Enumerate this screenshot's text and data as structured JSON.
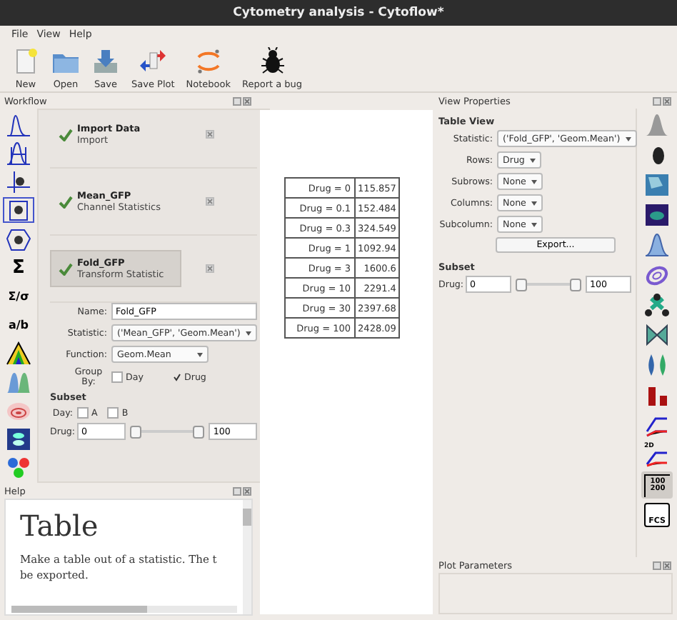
{
  "window": {
    "title": "Cytometry analysis - Cytoflow*"
  },
  "menu": [
    "File",
    "View",
    "Help"
  ],
  "toolbar": [
    {
      "kind": "new",
      "label": "New"
    },
    {
      "kind": "open",
      "label": "Open"
    },
    {
      "kind": "save",
      "label": "Save"
    },
    {
      "kind": "saveplot",
      "label": "Save Plot"
    },
    {
      "kind": "notebook",
      "label": "Notebook"
    },
    {
      "kind": "bug",
      "label": "Report a bug"
    }
  ],
  "workflow": {
    "title": "Workflow",
    "operations": [
      {
        "kind": "hist"
      },
      {
        "kind": "range"
      },
      {
        "kind": "threshold"
      },
      {
        "kind": "quad",
        "selected": true
      },
      {
        "kind": "polygon"
      },
      {
        "kind": "glyph",
        "text": "Σ"
      },
      {
        "kind": "glyph",
        "text": "Σ/σ"
      },
      {
        "kind": "glyph",
        "text": "a/b"
      },
      {
        "kind": "rainbow"
      },
      {
        "kind": "gmm"
      },
      {
        "kind": "kde"
      },
      {
        "kind": "flowpeaks"
      },
      {
        "kind": "dots"
      }
    ],
    "items": [
      {
        "name": "Import Data",
        "type": "Import",
        "selected": false
      },
      {
        "name": "Mean_GFP",
        "type": "Channel Statistics",
        "selected": false
      },
      {
        "name": "Fold_GFP",
        "type": "Transform Statistic",
        "selected": true
      }
    ],
    "form": {
      "name_label": "Name:",
      "name": "Fold_GFP",
      "statistic_label": "Statistic:",
      "statistic": "('Mean_GFP', 'Geom.Mean')",
      "function_label": "Function:",
      "function": "Geom.Mean",
      "group_label": "Group By:",
      "group": [
        {
          "label": "Day",
          "checked": false
        },
        {
          "label": "Drug",
          "checked": true
        }
      ],
      "subset_title": "Subset",
      "day_label": "Day:",
      "day": [
        {
          "label": "A",
          "checked": false
        },
        {
          "label": "B",
          "checked": false
        }
      ],
      "drug_label": "Drug:",
      "drug_low": "0",
      "drug_high": "100",
      "thumbs": [
        {
          "level": 0
        },
        {
          "level": 1
        }
      ]
    }
  },
  "help": {
    "title": "Help",
    "heading": "Table",
    "lines": [
      "Make a table out of a statistic. The t",
      "be exported."
    ]
  },
  "table": [
    {
      "label": "Drug = 0",
      "value": "115.857"
    },
    {
      "label": "Drug = 0.1",
      "value": "152.484"
    },
    {
      "label": "Drug = 0.3",
      "value": "324.549"
    },
    {
      "label": "Drug = 1",
      "value": "1092.94"
    },
    {
      "label": "Drug = 3",
      "value": "1600.6"
    },
    {
      "label": "Drug = 10",
      "value": "2291.4"
    },
    {
      "label": "Drug = 30",
      "value": "2397.68"
    },
    {
      "label": "Drug = 100",
      "value": "2428.09"
    }
  ],
  "view": {
    "title": "View Properties",
    "heading": "Table View",
    "fields": [
      {
        "label": "Statistic:",
        "value": "('Fold_GFP', 'Geom.Mean')"
      },
      {
        "label": "Rows:",
        "value": "Drug"
      },
      {
        "label": "Subrows:",
        "value": "None"
      },
      {
        "label": "Columns:",
        "value": "None"
      },
      {
        "label": "Subcolumn:",
        "value": "None"
      }
    ],
    "export": "Export...",
    "subset_title": "Subset",
    "drug_label": "Drug:",
    "drug_low": "0",
    "drug_high": "100",
    "thumbs": [
      {
        "level": 0
      },
      {
        "level": 1
      }
    ],
    "views": [
      {
        "kind": "hist"
      },
      {
        "kind": "blob"
      },
      {
        "kind": "density"
      },
      {
        "kind": "density2"
      },
      {
        "kind": "bell"
      },
      {
        "kind": "spiral"
      },
      {
        "kind": "nodes"
      },
      {
        "kind": "bowtie"
      },
      {
        "kind": "violin"
      },
      {
        "kind": "bars"
      },
      {
        "kind": "lines"
      },
      {
        "kind": "lines2d",
        "text": "2D"
      },
      {
        "kind": "table",
        "text": "100 200",
        "selected": true
      },
      {
        "kind": "fcs",
        "text": "FCS"
      }
    ]
  },
  "plot_params": {
    "title": "Plot Parameters"
  }
}
